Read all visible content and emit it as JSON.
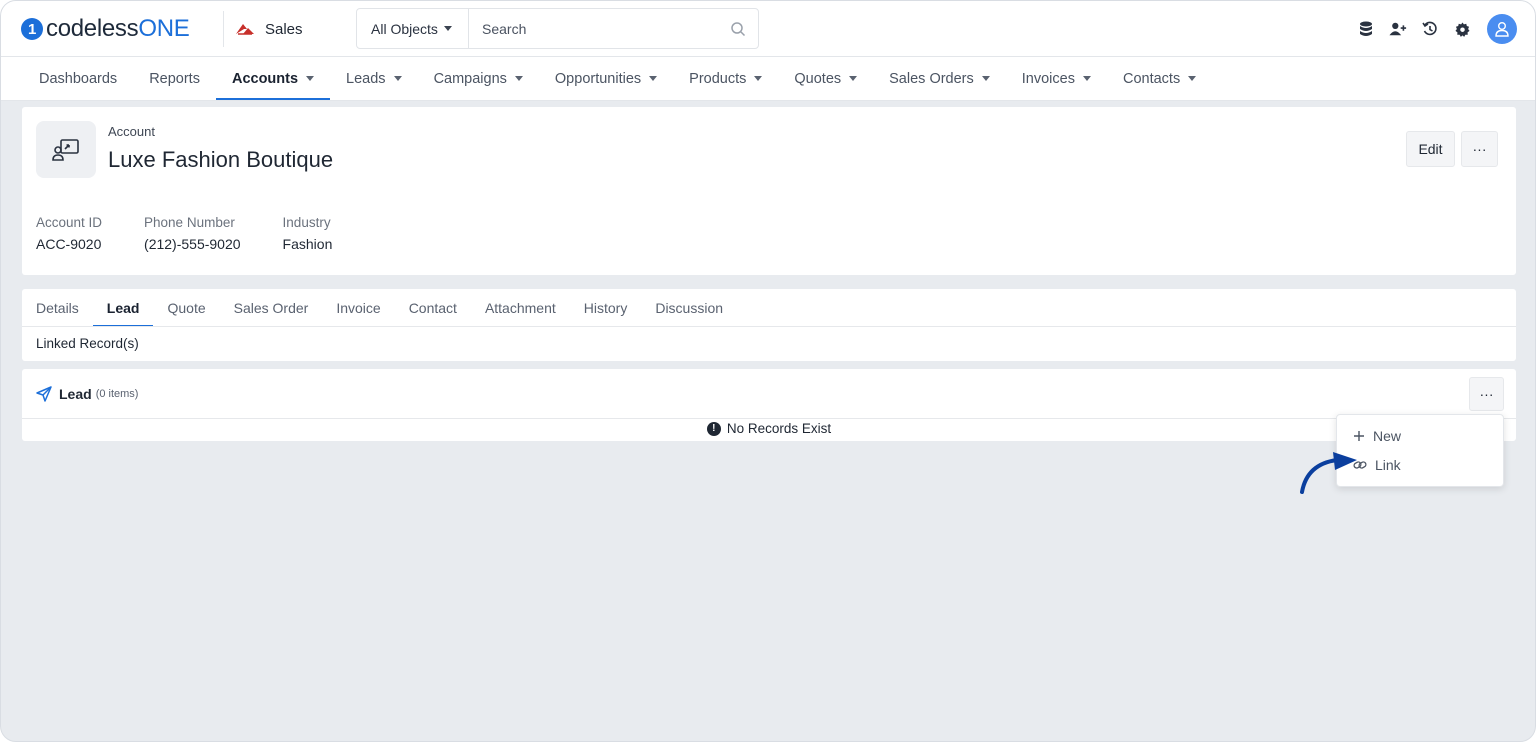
{
  "brand": {
    "logo_mark": "1",
    "logo_part1": "codeless",
    "logo_part2": "ONE",
    "accent": "#1c6fd9"
  },
  "app": {
    "name": "Sales",
    "icon": "sales-app-icon"
  },
  "search": {
    "scope": "All Objects",
    "placeholder": "Search"
  },
  "top_icons": [
    "database-icon",
    "add-user-icon",
    "history-icon",
    "gear-icon",
    "user-avatar-icon"
  ],
  "nav": {
    "items": [
      {
        "label": "Dashboards",
        "dropdown": false,
        "active": false
      },
      {
        "label": "Reports",
        "dropdown": false,
        "active": false
      },
      {
        "label": "Accounts",
        "dropdown": true,
        "active": true
      },
      {
        "label": "Leads",
        "dropdown": true,
        "active": false
      },
      {
        "label": "Campaigns",
        "dropdown": true,
        "active": false
      },
      {
        "label": "Opportunities",
        "dropdown": true,
        "active": false
      },
      {
        "label": "Products",
        "dropdown": true,
        "active": false
      },
      {
        "label": "Quotes",
        "dropdown": true,
        "active": false
      },
      {
        "label": "Sales Orders",
        "dropdown": true,
        "active": false
      },
      {
        "label": "Invoices",
        "dropdown": true,
        "active": false
      },
      {
        "label": "Contacts",
        "dropdown": true,
        "active": false
      }
    ]
  },
  "account": {
    "type_label": "Account",
    "name": "Luxe Fashion Boutique",
    "edit_label": "Edit",
    "more_label": "···",
    "fields": [
      {
        "label": "Account ID",
        "value": "ACC-9020"
      },
      {
        "label": "Phone Number",
        "value": "(212)-555-9020"
      },
      {
        "label": "Industry",
        "value": "Fashion"
      }
    ]
  },
  "tabs": {
    "items": [
      "Details",
      "Lead",
      "Quote",
      "Sales Order",
      "Invoice",
      "Contact",
      "Attachment",
      "History",
      "Discussion"
    ],
    "active": "Lead",
    "subtab": "Linked Record(s)"
  },
  "lead_section": {
    "title": "Lead",
    "count": "(0 items)",
    "more_label": "···",
    "empty_message": "No Records Exist"
  },
  "dropdown": {
    "items": [
      {
        "label": "New",
        "icon": "plus-icon"
      },
      {
        "label": "Link",
        "icon": "link-icon"
      }
    ]
  },
  "annotation_color": "#0b3f9e"
}
